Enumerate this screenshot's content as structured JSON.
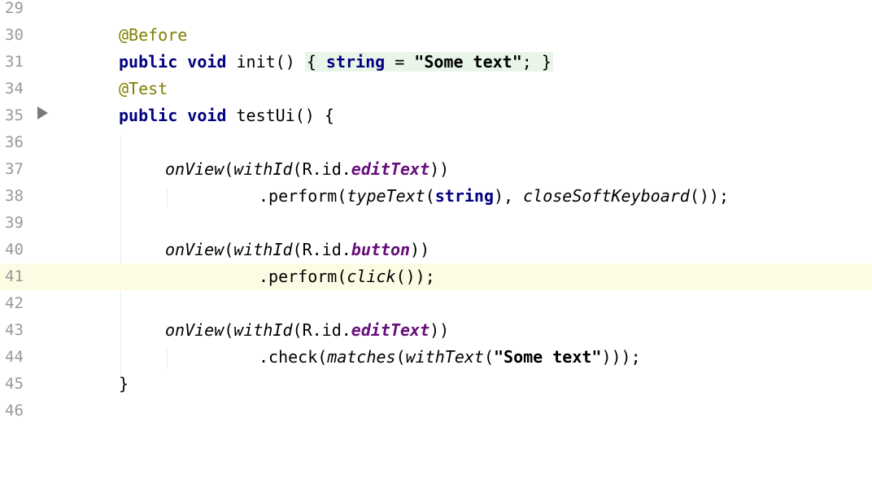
{
  "lines": [
    {
      "num": "29"
    },
    {
      "num": "30",
      "ann": "@Before"
    },
    {
      "num": "31",
      "kw1": "public",
      "kw2": "void",
      "name": "init()",
      "open": "{",
      "field": "string",
      "eq": " = ",
      "str": "\"Some text\"",
      "semi": ";",
      "close": "}"
    },
    {
      "num": "34",
      "ann": "@Test"
    },
    {
      "num": "35",
      "kw1": "public",
      "kw2": "void",
      "rest": "testUi() {"
    },
    {
      "num": "36"
    },
    {
      "num": "37",
      "m1": "onView",
      "p1": "(",
      "m2": "withId",
      "p2": "(R.id.",
      "fld": "editText",
      "p3": "))"
    },
    {
      "num": "38",
      "p1": ".perform(",
      "m1": "typeText",
      "p2": "(",
      "kw": "string",
      "p3": "), ",
      "m2": "closeSoftKeyboard",
      "p4": "());"
    },
    {
      "num": "39"
    },
    {
      "num": "40",
      "m1": "onView",
      "p1": "(",
      "m2": "withId",
      "p2": "(R.id.",
      "fld": "button",
      "p3": "))"
    },
    {
      "num": "41",
      "p1": ".perform(",
      "m1": "click",
      "p2": "());"
    },
    {
      "num": "42"
    },
    {
      "num": "43",
      "m1": "onView",
      "p1": "(",
      "m2": "withId",
      "p2": "(R.id.",
      "fld": "editText",
      "p3": "))"
    },
    {
      "num": "44",
      "p1": ".check(",
      "m1": "matches",
      "p2": "(",
      "m2": "withText",
      "p3": "(",
      "str": "\"Some text\"",
      "p4": ")));"
    },
    {
      "num": "45",
      "rest": "}"
    },
    {
      "num": "46"
    }
  ],
  "current_line": "41",
  "colors": {
    "keyword": "#000080",
    "annotation": "#808000",
    "field": "#660e7a",
    "line_number": "#999999",
    "current_line_bg": "#fdfbe3",
    "fold_bg": "#e8f5e8"
  },
  "gutter": {
    "run_icon": "run-test-icon"
  }
}
